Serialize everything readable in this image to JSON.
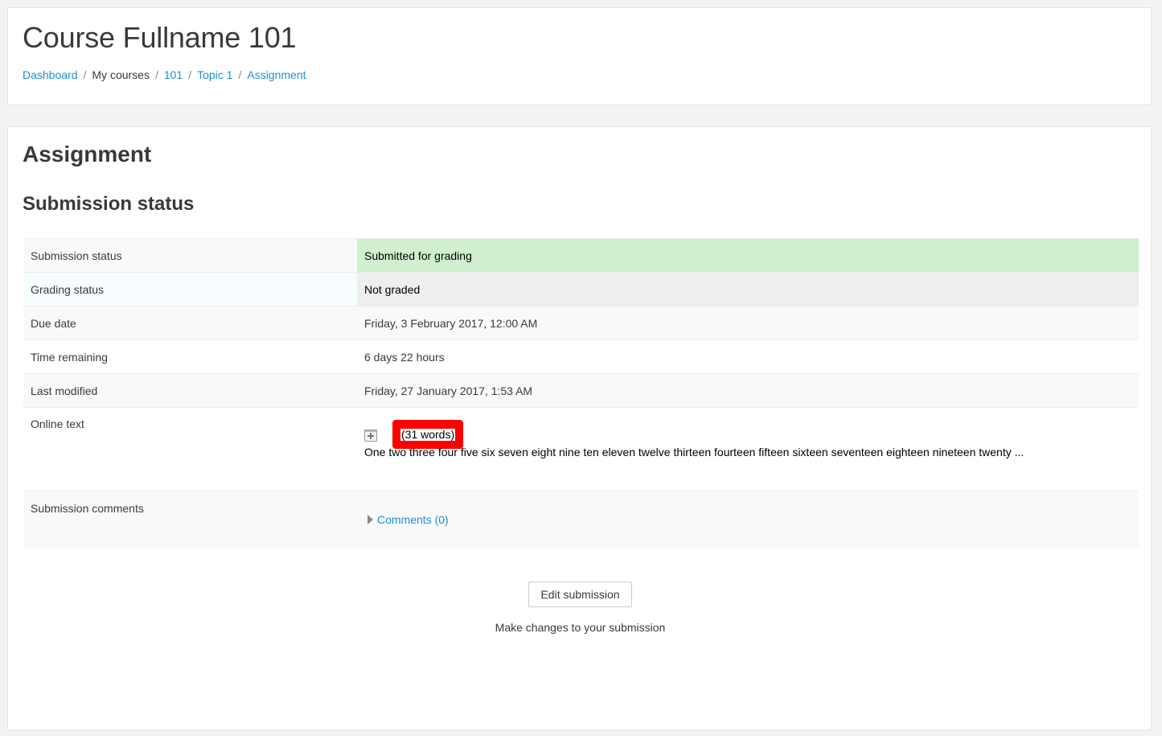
{
  "header": {
    "course_title": "Course Fullname 101",
    "breadcrumb": [
      {
        "label": "Dashboard",
        "link": true
      },
      {
        "label": "My courses",
        "link": false
      },
      {
        "label": "101",
        "link": true
      },
      {
        "label": "Topic 1",
        "link": true
      },
      {
        "label": "Assignment",
        "link": true
      }
    ],
    "breadcrumb_separator": "/"
  },
  "main": {
    "assignment_title": "Assignment",
    "section_title": "Submission status",
    "rows": [
      {
        "label": "Submission status",
        "value": "Submitted for grading",
        "status": "success"
      },
      {
        "label": "Grading status",
        "value": "Not graded",
        "status": "grey"
      },
      {
        "label": "Due date",
        "value": "Friday, 3 February 2017, 12:00 AM"
      },
      {
        "label": "Time remaining",
        "value": "6 days 22 hours"
      },
      {
        "label": "Last modified",
        "value": "Friday, 27 January 2017, 1:53 AM"
      },
      {
        "label": "Online text",
        "word_count": "(31 words)",
        "text": "One two three four five six seven eight nine ten eleven twelve thirteen fourteen fifteen sixteen seventeen eighteen nineteen twenty ..."
      },
      {
        "label": "Submission comments",
        "comments_link": "Comments (0)"
      }
    ],
    "edit_button": "Edit submission",
    "edit_help": "Make changes to your submission"
  },
  "colors": {
    "link": "#1a8fd8",
    "success_bg": "#cfefcf",
    "grey_bg": "#eeeeee",
    "highlight": "#ff0000"
  },
  "icons": {
    "expand": "expand-plus-icon",
    "comments_toggle": "caret-right-icon"
  }
}
